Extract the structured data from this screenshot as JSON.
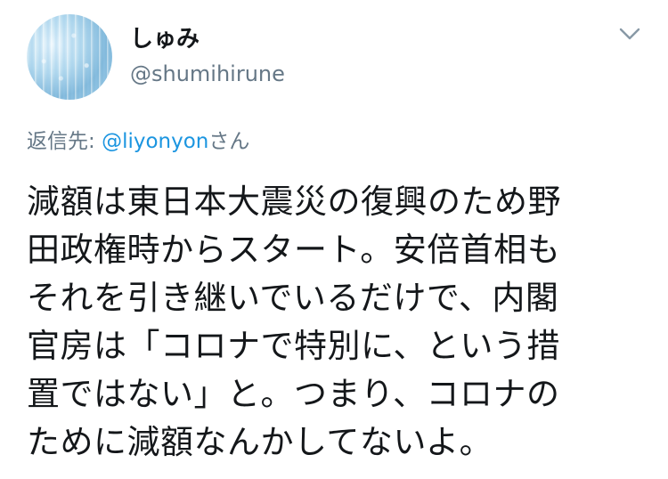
{
  "user": {
    "display_name": "しゅみ",
    "handle": "@shumihirune",
    "avatar_icon": "avatar-image"
  },
  "menu_icon": "chevron-down-icon",
  "reply": {
    "prefix": "返信先: ",
    "mention": "@liyonyon",
    "suffix": "さん"
  },
  "tweet": {
    "lines": [
      "減額は東日本大震災の復興のため野",
      "田政権時からスタート。安倍首相も",
      "それを引き継いでいるだけで、内閣",
      "官房は「コロナで特別に、という措",
      "置ではない」と。つまり、コロナの",
      "ために減額なんかしてないよ。"
    ]
  },
  "colors": {
    "text": "#14171a",
    "secondary": "#657786",
    "link": "#1b95e0"
  }
}
